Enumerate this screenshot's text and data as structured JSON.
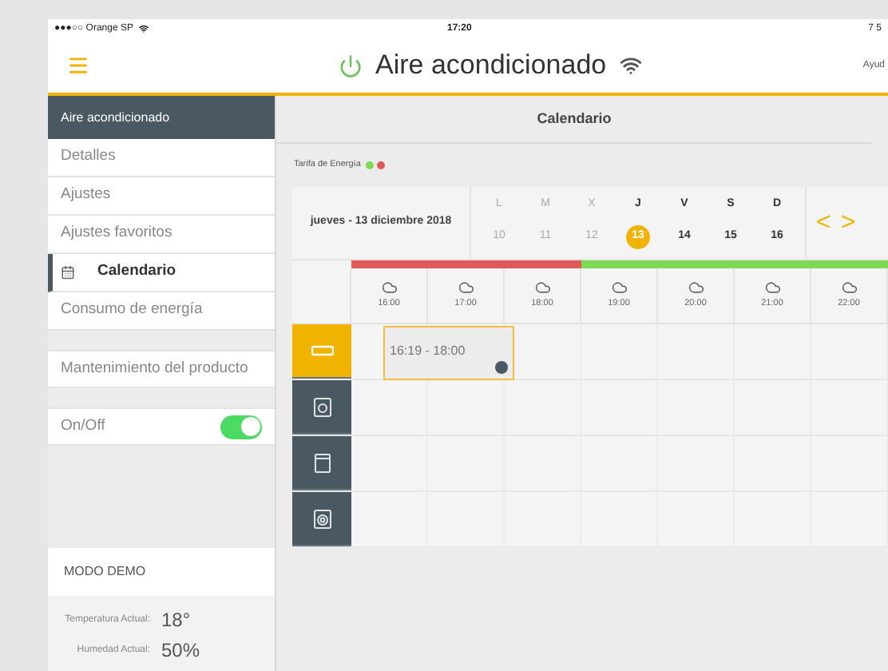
{
  "status_bar": {
    "carrier": "●●●○○ Orange SP",
    "time": "17:20",
    "battery": "7 5"
  },
  "header": {
    "title": "Aire acondicionado",
    "help": "Ayud"
  },
  "sidebar": {
    "section_title": "Aire acondicionado",
    "items": [
      {
        "label": "Detalles",
        "selected": false
      },
      {
        "label": "Ajustes",
        "selected": false
      },
      {
        "label": "Ajustes favoritos",
        "selected": false
      },
      {
        "label": "Calendario",
        "selected": true
      },
      {
        "label": "Consumo de energía",
        "selected": false
      }
    ],
    "maintenance": "Mantenimiento del producto",
    "toggle": {
      "label": "On/Off",
      "on": true
    },
    "demo": {
      "title": "MODO DEMO",
      "readings": [
        {
          "label": "Temperatura Actual:",
          "value": "18°"
        },
        {
          "label": "Humedad Actual:",
          "value": "50%"
        }
      ]
    }
  },
  "content": {
    "title": "Calendario",
    "tariff": {
      "label": "Tarifa de Energía",
      "dots": [
        {
          "color": "#7ed957"
        },
        {
          "color": "#e05a5a"
        }
      ]
    },
    "calendar": {
      "date": "jueves - 13 diciembre 2018",
      "days": [
        {
          "letter": "L",
          "number": "10",
          "past": true,
          "selected": false
        },
        {
          "letter": "M",
          "number": "11",
          "past": true,
          "selected": false
        },
        {
          "letter": "X",
          "number": "12",
          "past": true,
          "selected": false
        },
        {
          "letter": "J",
          "number": "13",
          "past": false,
          "selected": true
        },
        {
          "letter": "V",
          "number": "14",
          "past": false,
          "selected": false
        },
        {
          "letter": "S",
          "number": "15",
          "past": false,
          "selected": false
        },
        {
          "letter": "D",
          "number": "16",
          "past": false,
          "selected": false
        }
      ],
      "prev": "<",
      "next": ">"
    },
    "hours": [
      {
        "time": "16:00",
        "color": "#e05a5a"
      },
      {
        "time": "17:00",
        "color": "#e05a5a"
      },
      {
        "time": "18:00",
        "color": "#e05a5a"
      },
      {
        "time": "19:00",
        "color": "#7ed957"
      },
      {
        "time": "20:00",
        "color": "#7ed957"
      },
      {
        "time": "21:00",
        "color": "#7ed957"
      },
      {
        "time": "22:00",
        "color": "#7ed957"
      }
    ],
    "devices": [
      {
        "kind": "ac",
        "selected": true,
        "events": [
          {
            "label": "16:19 - 18:00"
          }
        ]
      },
      {
        "kind": "washer",
        "selected": false
      },
      {
        "kind": "oven",
        "selected": false
      },
      {
        "kind": "dryer",
        "selected": false
      }
    ]
  }
}
